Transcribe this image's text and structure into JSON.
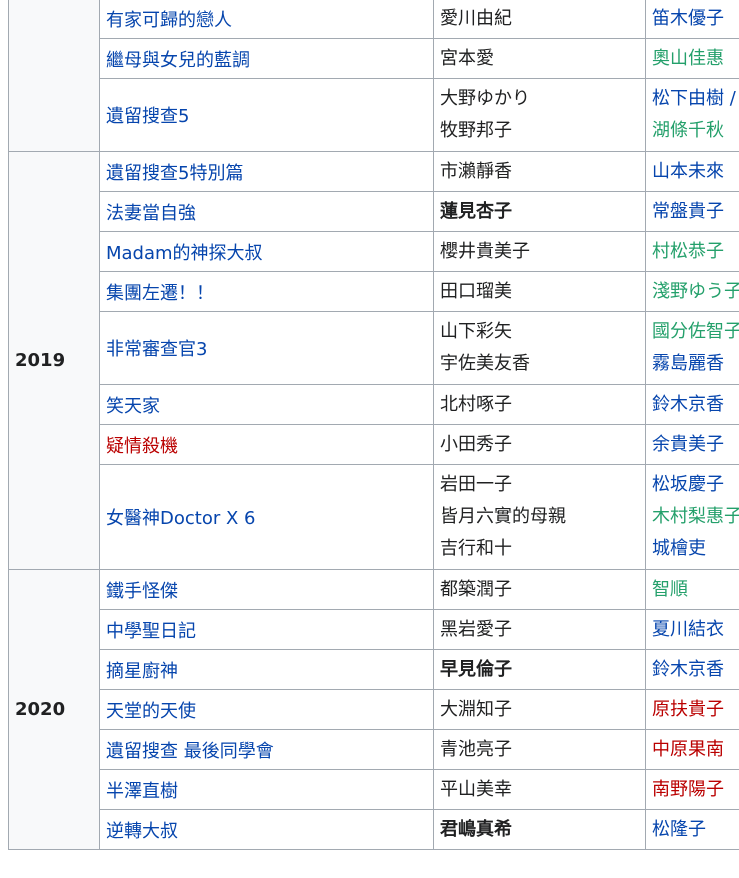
{
  "table": {
    "groups": [
      {
        "year": "",
        "rows": [
          {
            "title": "有家可歸的戀人",
            "title_color": "blue",
            "col2": [
              {
                "text": "愛川由紀",
                "bold": false
              }
            ],
            "col3": [
              {
                "text": "笛木優子",
                "color": "blue"
              }
            ]
          },
          {
            "title": "繼母與女兒的藍調",
            "title_color": "blue",
            "col2": [
              {
                "text": "宮本愛",
                "bold": false
              }
            ],
            "col3": [
              {
                "text": "奧山佳惠",
                "color": "green"
              }
            ]
          },
          {
            "title": "遺留搜查5",
            "title_color": "blue",
            "col2": [
              {
                "text": "大野ゆかり",
                "bold": false
              },
              {
                "text": "牧野邦子",
                "bold": false
              }
            ],
            "col3": [
              {
                "text": "松下由樹 /",
                "color": "blue"
              },
              {
                "text": "湖條千秋",
                "color": "green"
              }
            ]
          }
        ]
      },
      {
        "year": "2019",
        "rows": [
          {
            "title": "遺留搜查5特別篇",
            "title_color": "blue",
            "col2": [
              {
                "text": "市瀨靜香",
                "bold": false
              }
            ],
            "col3": [
              {
                "text": "山本未來",
                "color": "blue"
              }
            ]
          },
          {
            "title": "法妻當自強",
            "title_color": "blue",
            "col2": [
              {
                "text": "蓮見杏子",
                "bold": true
              }
            ],
            "col3": [
              {
                "text": "常盤貴子",
                "color": "blue"
              }
            ]
          },
          {
            "title": "Madam的神探大叔",
            "title_color": "blue",
            "col2": [
              {
                "text": "櫻井貴美子",
                "bold": false
              }
            ],
            "col3": [
              {
                "text": "村松恭子",
                "color": "green"
              }
            ]
          },
          {
            "title": "集團左遷！！",
            "title_color": "blue",
            "col2": [
              {
                "text": "田口瑠美",
                "bold": false
              }
            ],
            "col3": [
              {
                "text": "淺野ゆう子",
                "color": "green"
              }
            ]
          },
          {
            "title": "非常審查官3",
            "title_color": "blue",
            "col2": [
              {
                "text": "山下彩矢",
                "bold": false
              },
              {
                "text": "宇佐美友香",
                "bold": false
              }
            ],
            "col3": [
              {
                "text": "國分佐智子",
                "color": "green"
              },
              {
                "text": "霧島麗香",
                "color": "blue"
              }
            ]
          },
          {
            "title": "笑天家",
            "title_color": "blue",
            "col2": [
              {
                "text": "北村啄子",
                "bold": false
              }
            ],
            "col3": [
              {
                "text": "鈴木京香",
                "color": "blue"
              }
            ]
          },
          {
            "title": "疑情殺機",
            "title_color": "red",
            "col2": [
              {
                "text": "小田秀子",
                "bold": false
              }
            ],
            "col3": [
              {
                "text": "余貴美子",
                "color": "blue"
              }
            ]
          },
          {
            "title": "女醫神Doctor X 6",
            "title_color": "blue",
            "col2": [
              {
                "text": "岩田一子",
                "bold": false
              },
              {
                "text": "皆月六實的母親",
                "bold": false
              },
              {
                "text": "吉行和十",
                "bold": false
              }
            ],
            "col3": [
              {
                "text": "松坂慶子",
                "color": "blue"
              },
              {
                "text": "木村梨惠子",
                "color": "green"
              },
              {
                "text": "城檜吏",
                "color": "blue"
              }
            ]
          }
        ]
      },
      {
        "year": "2020",
        "rows": [
          {
            "title": "鐵手怪傑",
            "title_color": "blue",
            "col2": [
              {
                "text": "都築潤子",
                "bold": false
              }
            ],
            "col3": [
              {
                "text": "智順",
                "color": "green"
              }
            ]
          },
          {
            "title": "中學聖日記",
            "title_color": "blue",
            "col2": [
              {
                "text": "黑岩愛子",
                "bold": false
              }
            ],
            "col3": [
              {
                "text": "夏川結衣",
                "color": "blue"
              }
            ]
          },
          {
            "title": "摘星廚神",
            "title_color": "blue",
            "col2": [
              {
                "text": "早見倫子",
                "bold": true
              }
            ],
            "col3": [
              {
                "text": "鈴木京香",
                "color": "blue"
              }
            ]
          },
          {
            "title": "天堂的天使",
            "title_color": "blue",
            "col2": [
              {
                "text": "大淵知子",
                "bold": false
              }
            ],
            "col3": [
              {
                "text": "原扶貴子",
                "color": "red"
              }
            ]
          },
          {
            "title": "遺留搜查 最後同學會",
            "title_color": "blue",
            "col2": [
              {
                "text": "青池亮子",
                "bold": false
              }
            ],
            "col3": [
              {
                "text": "中原果南",
                "color": "red"
              }
            ]
          },
          {
            "title": "半澤直樹",
            "title_color": "blue",
            "col2": [
              {
                "text": "平山美幸",
                "bold": false
              }
            ],
            "col3": [
              {
                "text": "南野陽子",
                "color": "red"
              }
            ]
          },
          {
            "title": "逆轉大叔",
            "title_color": "blue",
            "col2": [
              {
                "text": "君嶋真希",
                "bold": true
              }
            ],
            "col3": [
              {
                "text": "松隆子",
                "color": "blue"
              }
            ]
          }
        ]
      }
    ]
  },
  "colors": {
    "blue": "#0645ad",
    "green": "#24a06b",
    "red": "#ba0000",
    "border": "#a2a9b1",
    "year_bg": "#f8f9fa"
  }
}
